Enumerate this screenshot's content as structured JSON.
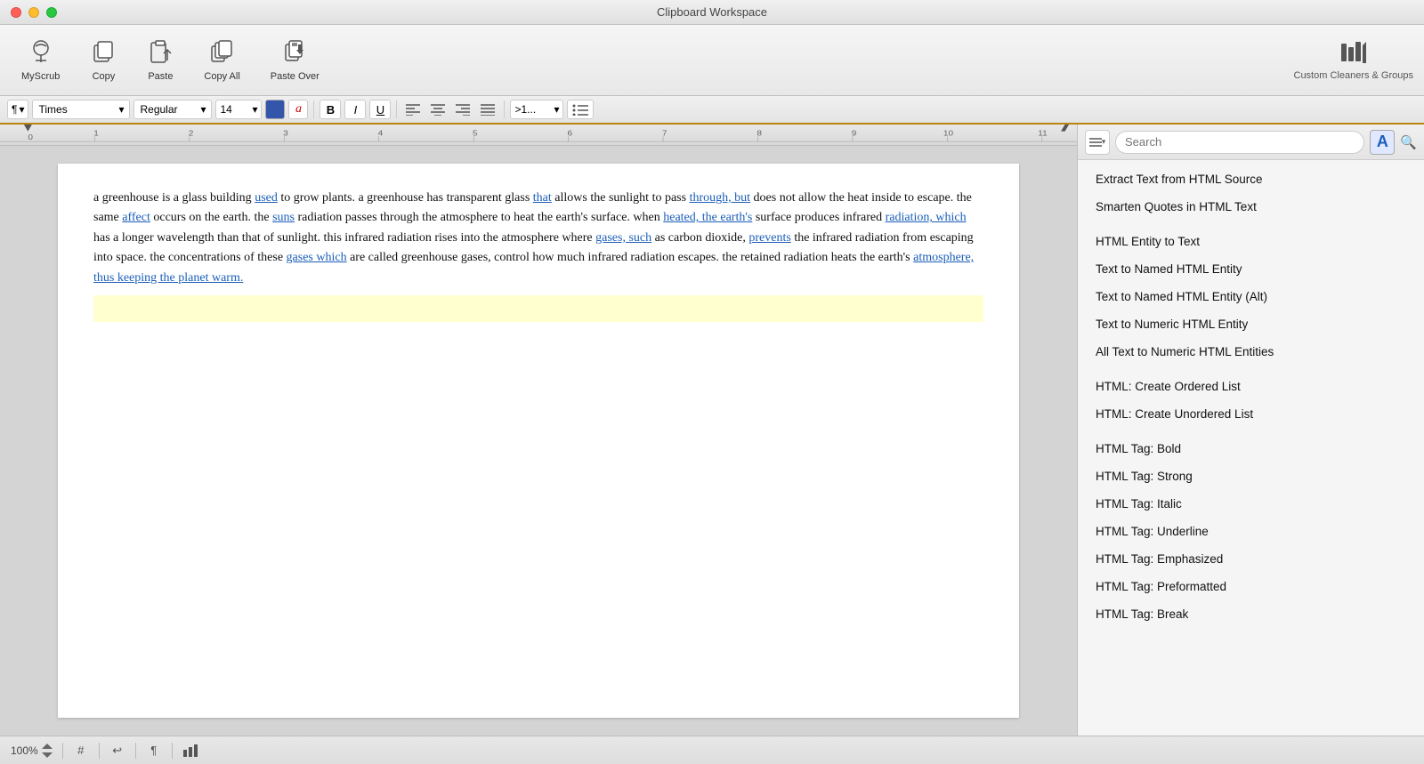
{
  "window": {
    "title": "Clipboard Workspace"
  },
  "toolbar": {
    "items": [
      {
        "id": "myscrub",
        "icon": "✦",
        "label": "MyScrub"
      },
      {
        "id": "copy",
        "icon": "⊟",
        "label": "Copy"
      },
      {
        "id": "paste",
        "icon": "✏",
        "label": "Paste"
      },
      {
        "id": "copyall",
        "icon": "⊞",
        "label": "Copy All"
      },
      {
        "id": "pasteover",
        "icon": "⬇",
        "label": "Paste Over"
      }
    ],
    "right": {
      "icon": "📶",
      "label": "Custom Cleaners & Groups"
    }
  },
  "formatbar": {
    "paragraph_label": "¶",
    "font": "Times",
    "style": "Regular",
    "size": "14",
    "color": "#3355aa",
    "text_color_label": "a",
    "bold": "B",
    "italic": "I",
    "underline": "U",
    "align_left": "≡",
    "align_center": "≡",
    "align_right": "≡",
    "align_justify": "≡",
    "list_ordered": ">1...",
    "list_unordered": "☰"
  },
  "editor": {
    "content": {
      "paragraph": "a greenhouse is a glass building used to grow plants. a greenhouse has transparent glass that allows the sunlight to pass through, but does not allow the heat inside to escape. the same affect occurs on the earth. the suns radiation passes through the atmosphere to heat the earth's surface. when heated, the earth's surface produces infrared radiation, which has a longer wavelength than that of sunlight. this infrared radiation rises into the atmosphere where gases, such as carbon dioxide, prevents the infrared radiation from escaping into space. the concentrations of these gases which are called greenhouse gases, control how much infrared radiation escapes. the retained radiation heats the earth's atmosphere, thus keeping the planet warm.",
      "links": [
        "used",
        "that",
        "through, but",
        "affect",
        "suns",
        "heated, the earth's",
        "radiation, which",
        "gases, such",
        "prevents",
        "gases which",
        "atmosphere, thus keeping the planet warm."
      ]
    }
  },
  "sidebar": {
    "search_placeholder": "Search",
    "items": [
      {
        "id": "extract-text-html",
        "label": "Extract Text from HTML Source"
      },
      {
        "id": "smarten-quotes",
        "label": "Smarten Quotes in HTML Text"
      },
      {
        "id": "html-entity-to-text",
        "label": "HTML Entity to Text"
      },
      {
        "id": "text-to-named-entity",
        "label": "Text to Named HTML Entity"
      },
      {
        "id": "text-to-named-entity-alt",
        "label": "Text to Named HTML Entity (Alt)"
      },
      {
        "id": "text-to-numeric-entity",
        "label": "Text to Numeric HTML Entity"
      },
      {
        "id": "all-text-numeric-entities",
        "label": "All Text to Numeric HTML Entities"
      },
      {
        "id": "html-ordered-list",
        "label": "HTML: Create Ordered List"
      },
      {
        "id": "html-unordered-list",
        "label": "HTML: Create Unordered List"
      },
      {
        "id": "html-tag-bold",
        "label": "HTML Tag: Bold"
      },
      {
        "id": "html-tag-strong",
        "label": "HTML Tag: Strong"
      },
      {
        "id": "html-tag-italic",
        "label": "HTML Tag: Italic"
      },
      {
        "id": "html-tag-underline",
        "label": "HTML Tag: Underline"
      },
      {
        "id": "html-tag-emphasized",
        "label": "HTML Tag: Emphasized"
      },
      {
        "id": "html-tag-preformatted",
        "label": "HTML Tag: Preformatted"
      },
      {
        "id": "html-tag-break",
        "label": "HTML Tag: Break"
      }
    ]
  },
  "statusbar": {
    "zoom": "100%",
    "zoom_icon": "⬆⬇",
    "hash_icon": "#",
    "undo_icon": "↩",
    "para_icon": "¶",
    "chart_icon": "📊"
  }
}
